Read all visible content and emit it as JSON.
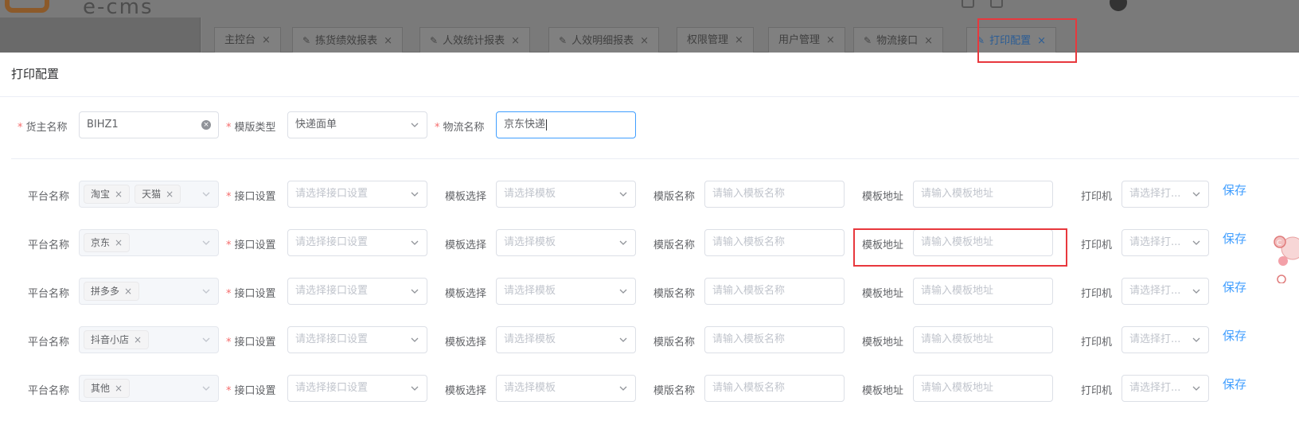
{
  "app": {
    "logo_text": "e-cms"
  },
  "tabs": [
    {
      "label": "主控台",
      "has_icon": false,
      "active": false
    },
    {
      "label": "拣货绩效报表",
      "has_icon": true,
      "active": false
    },
    {
      "label": "人效统计报表",
      "has_icon": true,
      "active": false
    },
    {
      "label": "人效明细报表",
      "has_icon": true,
      "active": false
    },
    {
      "label": "权限管理",
      "has_icon": false,
      "active": false
    },
    {
      "label": "用户管理",
      "has_icon": false,
      "active": false
    },
    {
      "label": "物流接口",
      "has_icon": true,
      "active": false
    },
    {
      "label": "打印配置",
      "has_icon": true,
      "active": true
    }
  ],
  "tab_close_glyph": "×",
  "dialog": {
    "title": "打印配置",
    "header_form": {
      "owner_label": "货主名称",
      "owner_value": "BIHZ1",
      "template_type_label": "模版类型",
      "template_type_value": "快递面单",
      "logistics_label": "物流名称",
      "logistics_value": "京东快递"
    },
    "row_labels": {
      "platform": "平台名称",
      "api": "接口设置",
      "template_select": "模板选择",
      "template_name": "模版名称",
      "template_addr": "模板地址",
      "printer": "打印机",
      "save": "保存"
    },
    "placeholders": {
      "api": "请选择接口设置",
      "template_select": "请选择模板",
      "template_name": "请输入模板名称",
      "template_addr": "请输入模板地址",
      "printer": "请选择打..."
    },
    "rows": [
      {
        "platforms": [
          "淘宝",
          "天猫"
        ]
      },
      {
        "platforms": [
          "京东"
        ]
      },
      {
        "platforms": [
          "拼多多"
        ]
      },
      {
        "platforms": [
          "抖音小店"
        ]
      },
      {
        "platforms": [
          "其他"
        ]
      }
    ]
  },
  "colors": {
    "accent": "#409eff",
    "required": "#f56c6c",
    "annotation": "#e8383d"
  }
}
